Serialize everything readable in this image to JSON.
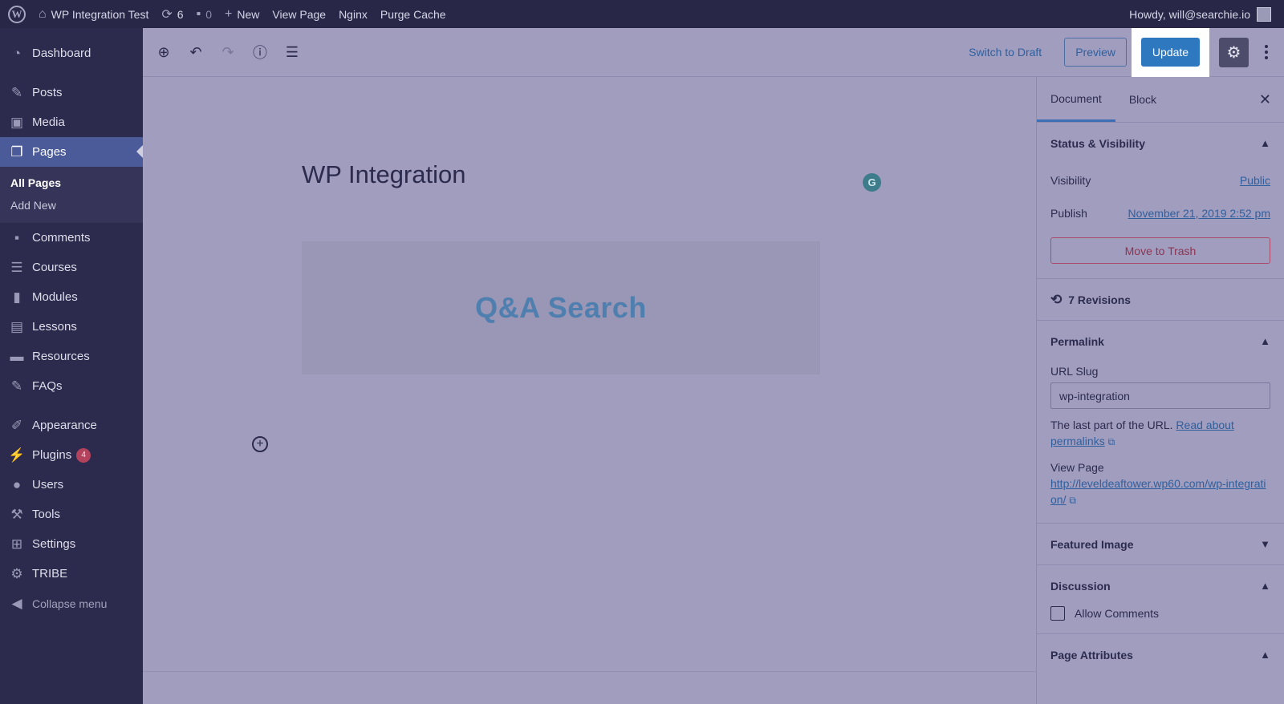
{
  "adminbar": {
    "site_name": "WP Integration Test",
    "updates_count": "6",
    "comments_count": "0",
    "new_label": "New",
    "view_page_label": "View Page",
    "nginx_label": "Nginx",
    "purge_cache_label": "Purge Cache",
    "howdy": "Howdy, will@searchie.io"
  },
  "sidebar": {
    "items": [
      {
        "label": "Dashboard"
      },
      {
        "label": "Posts"
      },
      {
        "label": "Media"
      },
      {
        "label": "Pages"
      },
      {
        "label": "Comments"
      },
      {
        "label": "Courses"
      },
      {
        "label": "Modules"
      },
      {
        "label": "Lessons"
      },
      {
        "label": "Resources"
      },
      {
        "label": "FAQs"
      },
      {
        "label": "Appearance"
      },
      {
        "label": "Plugins",
        "badge": "4"
      },
      {
        "label": "Users"
      },
      {
        "label": "Tools"
      },
      {
        "label": "Settings"
      },
      {
        "label": "TRIBE"
      }
    ],
    "submenu": [
      "All Pages",
      "Add New"
    ],
    "collapse_label": "Collapse menu"
  },
  "header": {
    "switch_to_draft": "Switch to Draft",
    "preview": "Preview",
    "update": "Update"
  },
  "editor": {
    "title": "WP Integration",
    "block_text": "Q&A Search"
  },
  "inspector": {
    "tab_document": "Document",
    "tab_block": "Block",
    "status_title": "Status & Visibility",
    "visibility_label": "Visibility",
    "visibility_value": "Public",
    "publish_label": "Publish",
    "publish_value": "November 21, 2019 2:52 pm",
    "trash_label": "Move to Trash",
    "revisions": "7 Revisions",
    "permalink_title": "Permalink",
    "url_slug_label": "URL Slug",
    "url_slug_value": "wp-integration",
    "help_text": "The last part of the URL.",
    "help_link": "Read about permalinks",
    "view_page_label": "View Page",
    "view_page_link": "http://leveldeaftower.wp60.com/wp-integration/",
    "featured_image_title": "Featured Image",
    "discussion_title": "Discussion",
    "allow_comments": "Allow Comments",
    "page_attributes_title": "Page Attributes"
  }
}
